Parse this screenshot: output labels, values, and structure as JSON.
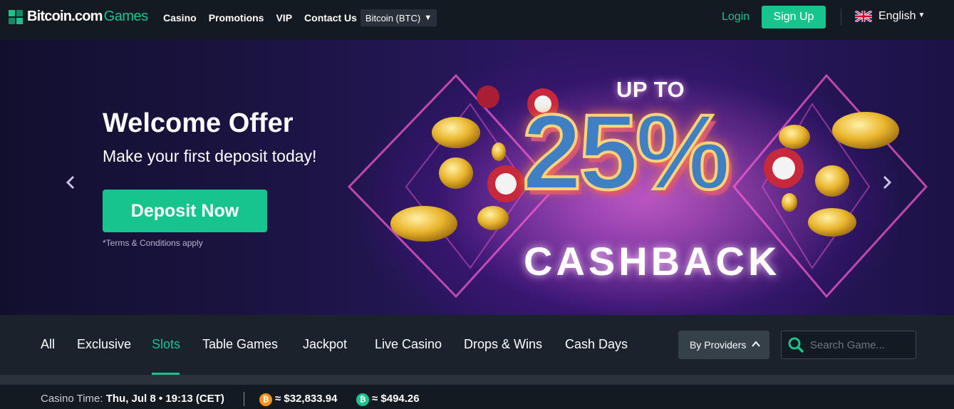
{
  "header": {
    "logo_brand": "Bitcoin.com",
    "logo_suffix": "Games",
    "nav": [
      "Casino",
      "Promotions",
      "VIP",
      "Contact Us"
    ],
    "currency": "Bitcoin (BTC)",
    "login": "Login",
    "signup": "Sign Up",
    "language": "English"
  },
  "hero": {
    "title": "Welcome Offer",
    "subtitle": "Make your first deposit today!",
    "cta": "Deposit Now",
    "terms": "*Terms & Conditions apply",
    "promo_upto": "UP TO",
    "promo_value": "25%",
    "promo_word": "CASHBACK"
  },
  "categories": {
    "items": [
      "All",
      "Exclusive",
      "Slots",
      "Table Games",
      "Jackpot",
      "Live Casino",
      "Drops & Wins",
      "Cash Days"
    ],
    "active": "Slots",
    "providers_label": "By Providers",
    "search_placeholder": "Search Game..."
  },
  "status": {
    "time_label": "Casino Time:",
    "time_value": "Thu, Jul 8 • 19:13 (CET)",
    "btc_symbol": "₿",
    "btc_price": "≈ $32,833.94",
    "bch_symbol": "₿",
    "bch_price": "≈ $494.26"
  },
  "colors": {
    "accent": "#17c48d",
    "background": "#131a22",
    "btc": "#f7931a"
  }
}
